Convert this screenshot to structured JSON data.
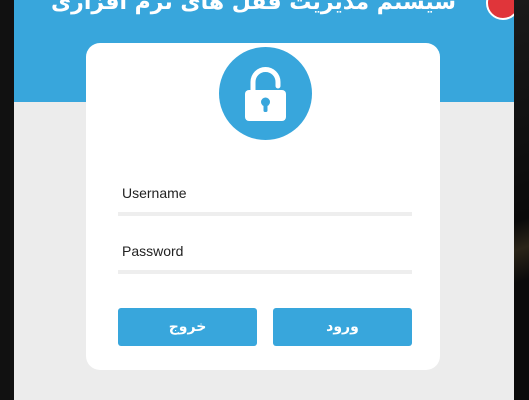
{
  "header": {
    "title": "سیستم مدیریت قفل های نرم افزاری",
    "logo_icon": "red-logo-badge"
  },
  "login": {
    "lock_icon": "padlock-icon",
    "username_placeholder": "Username",
    "password_placeholder": "Password",
    "login_label": "ورود",
    "exit_label": "خروج"
  },
  "colors": {
    "accent": "#38a6dc",
    "background": "#ececec",
    "card": "#ffffff",
    "badge": "#e0353a"
  }
}
